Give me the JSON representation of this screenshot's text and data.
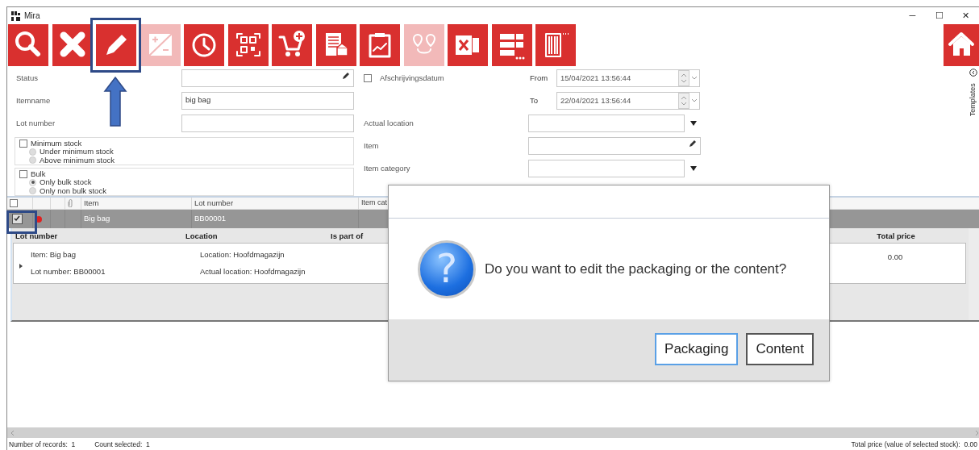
{
  "window": {
    "title": "Mira",
    "controls": [
      "─",
      "☐",
      "✕"
    ]
  },
  "toolbar": [
    {
      "kind": "search",
      "disabled": false
    },
    {
      "kind": "close",
      "disabled": false
    },
    {
      "kind": "pencil",
      "disabled": false
    },
    {
      "kind": "plusminus",
      "disabled": true
    },
    {
      "kind": "clock",
      "disabled": false
    },
    {
      "kind": "qr",
      "disabled": false
    },
    {
      "kind": "cart",
      "disabled": false
    },
    {
      "kind": "document",
      "disabled": false
    },
    {
      "kind": "clipboard",
      "disabled": false
    },
    {
      "kind": "pins",
      "disabled": true
    },
    {
      "kind": "sheet",
      "disabled": false
    },
    {
      "kind": "panels",
      "disabled": false
    },
    {
      "kind": "barcode",
      "disabled": false
    },
    {
      "kind": "home",
      "disabled": false
    }
  ],
  "filters_left": [
    {
      "label": "Status",
      "kind": "edit"
    },
    {
      "label": "Itemname",
      "kind": "text",
      "value": "big bag"
    },
    {
      "label": "Lot number",
      "kind": "text"
    }
  ],
  "filter_groups": [
    {
      "label": "Minimum stock",
      "checked": false,
      "options": [
        {
          "label": "Under minimum stock",
          "selected": false
        },
        {
          "label": "Above minimum stock",
          "selected": false
        }
      ]
    },
    {
      "label": "Bulk",
      "checked": false,
      "options": [
        {
          "label": "Only bulk stock",
          "selected": true
        },
        {
          "label": "Only non bulk stock",
          "selected": false
        }
      ]
    }
  ],
  "date_filter": {
    "label": "Afschrijvingsdatum",
    "checked": false,
    "from": {
      "label": "From",
      "value": "15/04/2021 13:56:44"
    },
    "to": {
      "label": "To",
      "value": "22/04/2021 13:56:44"
    }
  },
  "filters_middle": [
    {
      "label": "Actual location",
      "kind": "dropdown"
    },
    {
      "label": "Item",
      "kind": "edit"
    },
    {
      "label": "Item category",
      "kind": "dropdown"
    }
  ],
  "side_tab": {
    "label": "Templates"
  },
  "grid": {
    "select_all_checked": false,
    "columns": [
      "Item",
      "Lot number",
      "Item cat"
    ],
    "rows": [
      {
        "checked": true,
        "selected": true,
        "color": "#e02020",
        "item": "Big bag",
        "lot_number": "BB00001"
      }
    ]
  },
  "detail": {
    "columns": [
      "Lot number",
      "Location",
      "Is part of",
      "Total price"
    ],
    "rows": [
      {
        "item": "Item: Big bag",
        "lot_number": "Lot number: BB00001",
        "location": "Location: Hoofdmagazijn",
        "actual_location": "Actual location: Hoofdmagazijn",
        "total_price": "0.00"
      }
    ]
  },
  "status_bar": {
    "left": [
      {
        "label": "Number of records:",
        "value": "1"
      },
      {
        "label": "Count selected:",
        "value": "1"
      }
    ],
    "right": {
      "label": "Total price (value of selected stock):",
      "value": "0.00"
    }
  },
  "dialog": {
    "icon_glyph": "?",
    "message": "Do you want to edit the packaging or the content?",
    "buttons": [
      {
        "label": "Packaging",
        "focused": true
      },
      {
        "label": "Content",
        "focused": false
      }
    ]
  }
}
